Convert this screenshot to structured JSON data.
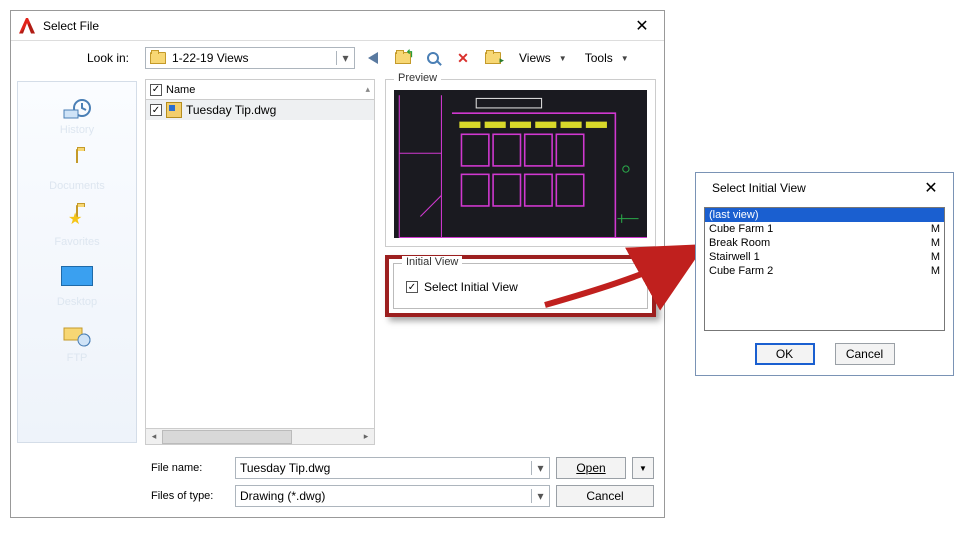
{
  "main": {
    "title": "Select File",
    "lookin_label": "Look in:",
    "lookin_value": "1-22-19 Views",
    "menus": {
      "views": "Views",
      "tools": "Tools"
    },
    "sidebar": [
      {
        "id": "history",
        "label": "History"
      },
      {
        "id": "documents",
        "label": "Documents"
      },
      {
        "id": "favorites",
        "label": "Favorites"
      },
      {
        "id": "desktop",
        "label": "Desktop"
      },
      {
        "id": "ftp",
        "label": "FTP"
      }
    ],
    "filelist": {
      "header": "Name",
      "rows": [
        {
          "name": "Tuesday Tip.dwg",
          "checked": true
        }
      ]
    },
    "preview": {
      "label": "Preview"
    },
    "initial_view": {
      "group_label": "Initial View",
      "checkbox_label": "Select Initial View",
      "checked": true
    },
    "filename_label": "File name:",
    "filename_value": "Tuesday Tip.dwg",
    "filetype_label": "Files of type:",
    "filetype_value": "Drawing (*.dwg)",
    "open_label": "Open",
    "cancel_label": "Cancel"
  },
  "siv": {
    "title": "Select Initial View",
    "items": [
      {
        "name": "(last view)",
        "flag": "",
        "selected": true
      },
      {
        "name": "Cube Farm 1",
        "flag": "M",
        "selected": false
      },
      {
        "name": "Break Room",
        "flag": "M",
        "selected": false
      },
      {
        "name": "Stairwell 1",
        "flag": "M",
        "selected": false
      },
      {
        "name": "Cube Farm 2",
        "flag": "M",
        "selected": false
      }
    ],
    "ok_label": "OK",
    "cancel_label": "Cancel"
  }
}
